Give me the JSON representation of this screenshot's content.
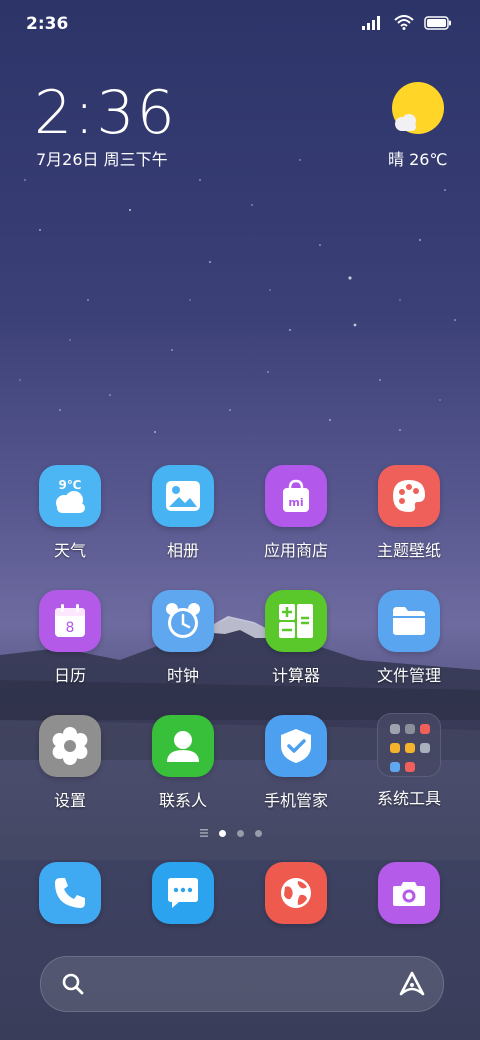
{
  "status": {
    "time": "2:36"
  },
  "widget": {
    "time": "2:36",
    "date": "7月26日 周三下午",
    "weather": "晴 26℃"
  },
  "apps": [
    {
      "label": "天气",
      "icon": "weather-icon",
      "temp": "9℃"
    },
    {
      "label": "相册",
      "icon": "gallery-icon"
    },
    {
      "label": "应用商店",
      "icon": "app-store-icon",
      "badge": "mi"
    },
    {
      "label": "主题壁纸",
      "icon": "themes-icon"
    },
    {
      "label": "日历",
      "icon": "calendar-icon",
      "day": "8"
    },
    {
      "label": "时钟",
      "icon": "clock-icon"
    },
    {
      "label": "计算器",
      "icon": "calculator-icon"
    },
    {
      "label": "文件管理",
      "icon": "file-manager-icon"
    },
    {
      "label": "设置",
      "icon": "settings-icon"
    },
    {
      "label": "联系人",
      "icon": "contacts-icon"
    },
    {
      "label": "手机管家",
      "icon": "security-icon"
    },
    {
      "label": "系统工具",
      "icon": "system-tools-folder-icon"
    }
  ],
  "dock": [
    {
      "icon": "phone-icon"
    },
    {
      "icon": "messages-icon"
    },
    {
      "icon": "browser-icon"
    },
    {
      "icon": "camera-icon"
    }
  ],
  "pager": {
    "pages": 3,
    "active": 1
  },
  "colors": {
    "weather": "#4bb6f3",
    "gallery": "#48b3f2",
    "store": "#b259ec",
    "themes": "#f0605a",
    "calendar": "#b35ae8",
    "clock": "#5fa7ee",
    "calc": "#5ac82b",
    "files": "#5aa5ef",
    "settings": "#8f8f8f",
    "contacts": "#39c03b",
    "security": "#4d9ff0",
    "phone": "#3faaf2",
    "messages": "#2ba3ef",
    "browser": "#ef5a4f",
    "camera": "#b45ce9",
    "sun": "#ffd528"
  }
}
